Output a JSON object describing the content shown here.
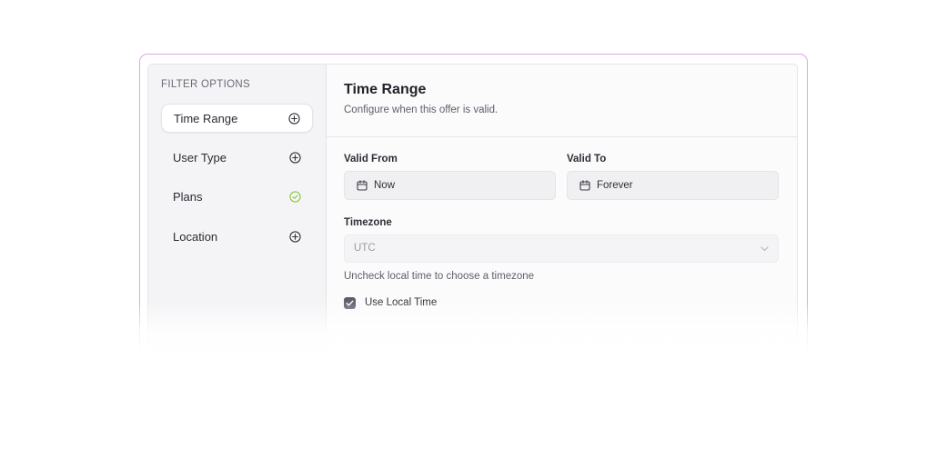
{
  "sidebar": {
    "heading": "FILTER OPTIONS",
    "items": [
      {
        "label": "Time Range",
        "icon": "plus-circle-icon",
        "active": true
      },
      {
        "label": "User Type",
        "icon": "plus-circle-icon",
        "active": false
      },
      {
        "label": "Plans",
        "icon": "check-circle-icon",
        "active": false
      },
      {
        "label": "Location",
        "icon": "plus-circle-icon",
        "active": false
      }
    ]
  },
  "main": {
    "title": "Time Range",
    "subtitle": "Configure when this offer is valid.",
    "valid_from": {
      "label": "Valid From",
      "value": "Now"
    },
    "valid_to": {
      "label": "Valid To",
      "value": "Forever"
    },
    "timezone": {
      "label": "Timezone",
      "value": "UTC"
    },
    "hint": "Uncheck local time to choose a timezone",
    "local_time": {
      "label": "Use Local Time",
      "checked": true
    }
  },
  "colors": {
    "frame_border": "#dfa6e6",
    "check_green": "#8cc63f",
    "checkbox_fill": "#5c5c6a"
  }
}
